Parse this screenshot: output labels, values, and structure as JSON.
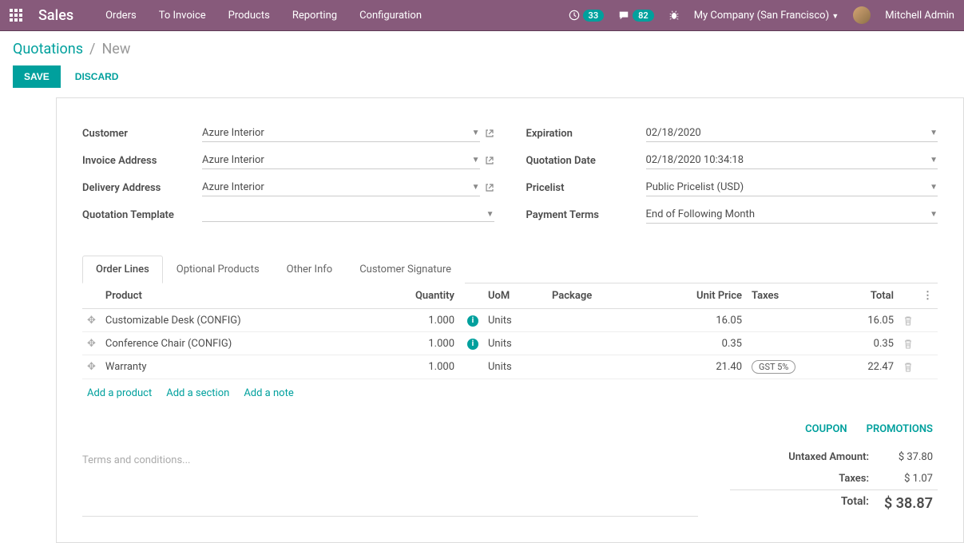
{
  "topbar": {
    "brand": "Sales",
    "menu": [
      "Orders",
      "To Invoice",
      "Products",
      "Reporting",
      "Configuration"
    ],
    "clock_badge": "33",
    "chat_badge": "82",
    "company": "My Company (San Francisco)",
    "user": "Mitchell Admin"
  },
  "breadcrumb": {
    "root": "Quotations",
    "current": "New"
  },
  "actions": {
    "save": "SAVE",
    "discard": "DISCARD"
  },
  "form": {
    "left": {
      "customer_label": "Customer",
      "customer_value": "Azure Interior",
      "invoice_addr_label": "Invoice Address",
      "invoice_addr_value": "Azure Interior",
      "delivery_addr_label": "Delivery Address",
      "delivery_addr_value": "Azure Interior",
      "template_label": "Quotation Template",
      "template_value": ""
    },
    "right": {
      "expiration_label": "Expiration",
      "expiration_value": "02/18/2020",
      "qdate_label": "Quotation Date",
      "qdate_value": "02/18/2020 10:34:18",
      "pricelist_label": "Pricelist",
      "pricelist_value": "Public Pricelist (USD)",
      "terms_label": "Payment Terms",
      "terms_value": "End of Following Month"
    }
  },
  "tabs": [
    "Order Lines",
    "Optional Products",
    "Other Info",
    "Customer Signature"
  ],
  "table": {
    "headers": {
      "product": "Product",
      "quantity": "Quantity",
      "uom": "UoM",
      "package": "Package",
      "unit_price": "Unit Price",
      "taxes": "Taxes",
      "total": "Total"
    },
    "rows": [
      {
        "product": "Customizable Desk (CONFIG)",
        "qty": "1.000",
        "info": true,
        "uom": "Units",
        "package": "",
        "unit_price": "16.05",
        "taxes": "",
        "total": "16.05"
      },
      {
        "product": "Conference Chair (CONFIG)",
        "qty": "1.000",
        "info": true,
        "uom": "Units",
        "package": "",
        "unit_price": "0.35",
        "taxes": "",
        "total": "0.35"
      },
      {
        "product": "Warranty",
        "qty": "1.000",
        "info": false,
        "uom": "Units",
        "package": "",
        "unit_price": "21.40",
        "taxes": "GST 5%",
        "total": "22.47"
      }
    ],
    "add_product": "Add a product",
    "add_section": "Add a section",
    "add_note": "Add a note"
  },
  "links": {
    "coupon": "COUPON",
    "promotions": "PROMOTIONS"
  },
  "terms_placeholder": "Terms and conditions...",
  "totals": {
    "untaxed_label": "Untaxed Amount:",
    "untaxed_value": "$ 37.80",
    "taxes_label": "Taxes:",
    "taxes_value": "$ 1.07",
    "total_label": "Total:",
    "total_value": "$ 38.87"
  }
}
